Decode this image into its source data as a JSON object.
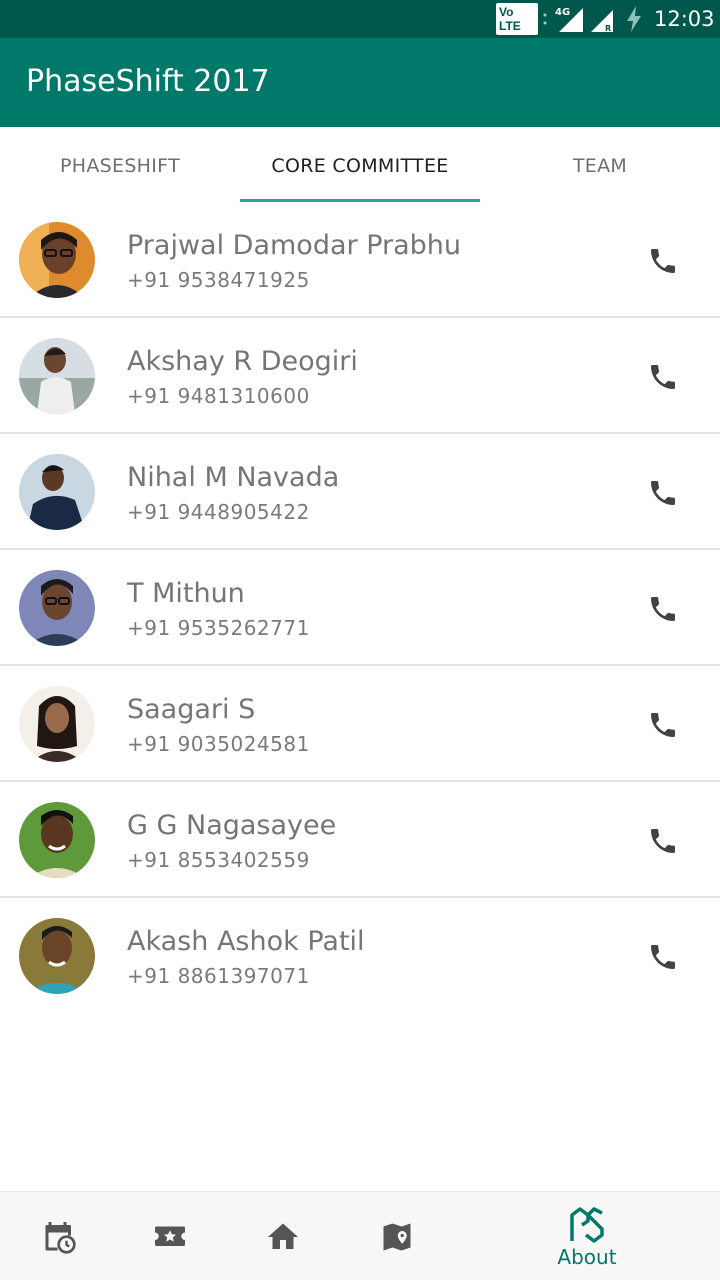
{
  "status_bar": {
    "network_badge": "Vo LTE",
    "network_type": "4G",
    "time": "12:03",
    "icons": [
      "volte-icon",
      "signal-4g-icon",
      "signal-roaming-icon",
      "battery-charging-icon"
    ]
  },
  "app_bar": {
    "title": "PhaseShift 2017"
  },
  "colors": {
    "status_bar": "#00574b",
    "primary": "#00796b",
    "accent": "#26a69a",
    "text_secondary": "#757575",
    "icon": "#424242"
  },
  "tabs": [
    {
      "label": "PHASESHIFT",
      "active": false
    },
    {
      "label": "CORE COMMITTEE",
      "active": true
    },
    {
      "label": "TEAM",
      "active": false
    }
  ],
  "contacts": [
    {
      "name": "Prajwal Damodar Prabhu",
      "phone": "+91 9538471925",
      "icon": "phone-icon"
    },
    {
      "name": "Akshay R Deogiri",
      "phone": "+91 9481310600",
      "icon": "phone-icon"
    },
    {
      "name": "Nihal M Navada",
      "phone": "+91 9448905422",
      "icon": "phone-icon"
    },
    {
      "name": "T Mithun",
      "phone": "+91 9535262771",
      "icon": "phone-icon"
    },
    {
      "name": "Saagari S",
      "phone": "+91 9035024581",
      "icon": "phone-icon"
    },
    {
      "name": "G G Nagasayee",
      "phone": "+91 8553402559",
      "icon": "phone-icon"
    },
    {
      "name": "Akash Ashok Patil",
      "phone": "+91 8861397071",
      "icon": "phone-icon"
    }
  ],
  "bottom_nav": {
    "items": [
      {
        "icon": "calendar-clock-icon"
      },
      {
        "icon": "ticket-star-icon"
      },
      {
        "icon": "home-icon"
      },
      {
        "icon": "map-pin-icon"
      },
      {
        "icon": "phaseshift-logo-icon",
        "label": "About",
        "active": true
      }
    ]
  }
}
